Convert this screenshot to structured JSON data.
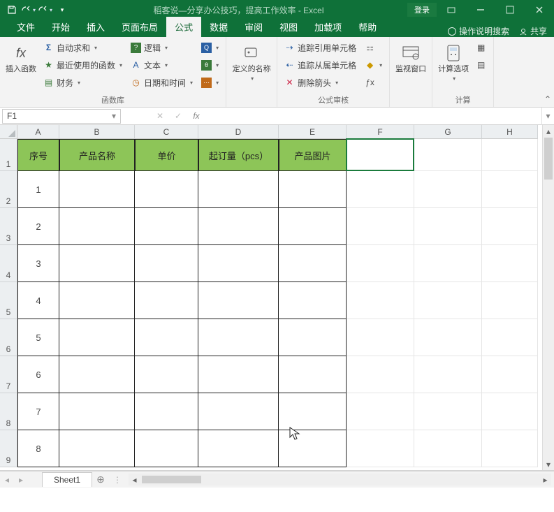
{
  "title": "稻客说—分享办公技巧，提高工作效率 - Excel",
  "login": "登录",
  "tabs": [
    "文件",
    "开始",
    "插入",
    "页面布局",
    "公式",
    "数据",
    "审阅",
    "视图",
    "加载项",
    "帮助"
  ],
  "active_tab": 4,
  "tell_me": "操作说明搜索",
  "share": "共享",
  "ribbon": {
    "group1": {
      "label": "函数库",
      "insert_fn": "插入函数",
      "autosum": "自动求和",
      "recent": "最近使用的函数",
      "financial": "财务",
      "logical": "逻辑",
      "text": "文本",
      "datetime": "日期和时间"
    },
    "group2": {
      "label": "",
      "define_name": "定义的名称"
    },
    "group3": {
      "label": "公式审核",
      "trace_prec": "追踪引用单元格",
      "trace_dep": "追踪从属单元格",
      "remove_arrows": "删除箭头"
    },
    "group4": {
      "label": "",
      "watch": "监视窗口"
    },
    "group5": {
      "label": "计算",
      "calc_options": "计算选项"
    }
  },
  "namebox": "F1",
  "columns": [
    {
      "letter": "A",
      "w": 60
    },
    {
      "letter": "B",
      "w": 108
    },
    {
      "letter": "C",
      "w": 91
    },
    {
      "letter": "D",
      "w": 115
    },
    {
      "letter": "E",
      "w": 97
    },
    {
      "letter": "F",
      "w": 97
    },
    {
      "letter": "G",
      "w": 97
    },
    {
      "letter": "H",
      "w": 80
    }
  ],
  "row_heights": {
    "header": 46,
    "data": 53
  },
  "visible_rows": 9,
  "table_headers": [
    "序号",
    "产品名称",
    "单价",
    "起订量（pcs）",
    "产品图片"
  ],
  "data_rows": [
    "1",
    "2",
    "3",
    "4",
    "5",
    "6",
    "7",
    "8"
  ],
  "sheet_tab": "Sheet1",
  "selected_cell": {
    "col": 5,
    "row": 0
  }
}
